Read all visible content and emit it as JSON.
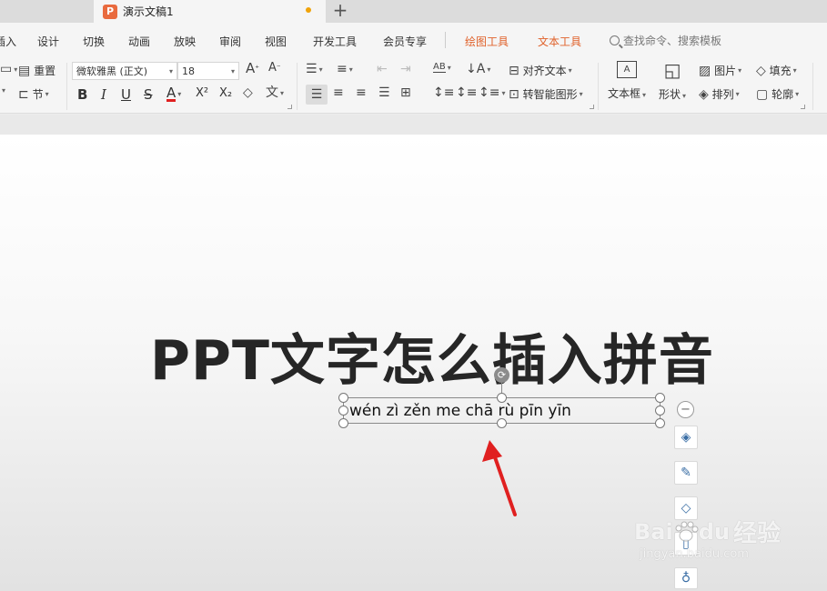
{
  "tabs": {
    "doc_title": "演示文稿1",
    "add_label": "+"
  },
  "menu": {
    "items": [
      "插入",
      "设计",
      "切换",
      "动画",
      "放映",
      "审阅",
      "视图",
      "开发工具",
      "会员专享",
      "绘图工具",
      "文本工具"
    ],
    "search_placeholder": "查找命令、搜索模板"
  },
  "ribbon": {
    "reset_label": "重置",
    "section_label": "节",
    "font_name": "微软雅黑 (正文)",
    "font_size": "18",
    "bold_label": "B",
    "italic_label": "I",
    "underline_label": "U",
    "strike_label": "S",
    "font_color_label": "A",
    "superscript_label": "X²",
    "subscript_label": "X₂",
    "align_text_label": "对齐文本",
    "smartart_label": "转智能图形",
    "textbox_label": "文本框",
    "shape_label": "形状",
    "picture_label": "图片",
    "arrange_label": "排列",
    "fill_label": "填充",
    "outline_label": "轮廓"
  },
  "slide": {
    "title": "PPT文字怎么插入拼音",
    "pinyin_text": "wén zì zěn me chā rù pīn yīn"
  },
  "watermark": {
    "brand": "Bai",
    "brand_suffix": "du",
    "cn": "经验",
    "url": "jingyan.baidu.com"
  },
  "colors": {
    "accent_orange": "#e0622b",
    "arrow_red": "#e02020",
    "logo": "#e96a3e"
  }
}
